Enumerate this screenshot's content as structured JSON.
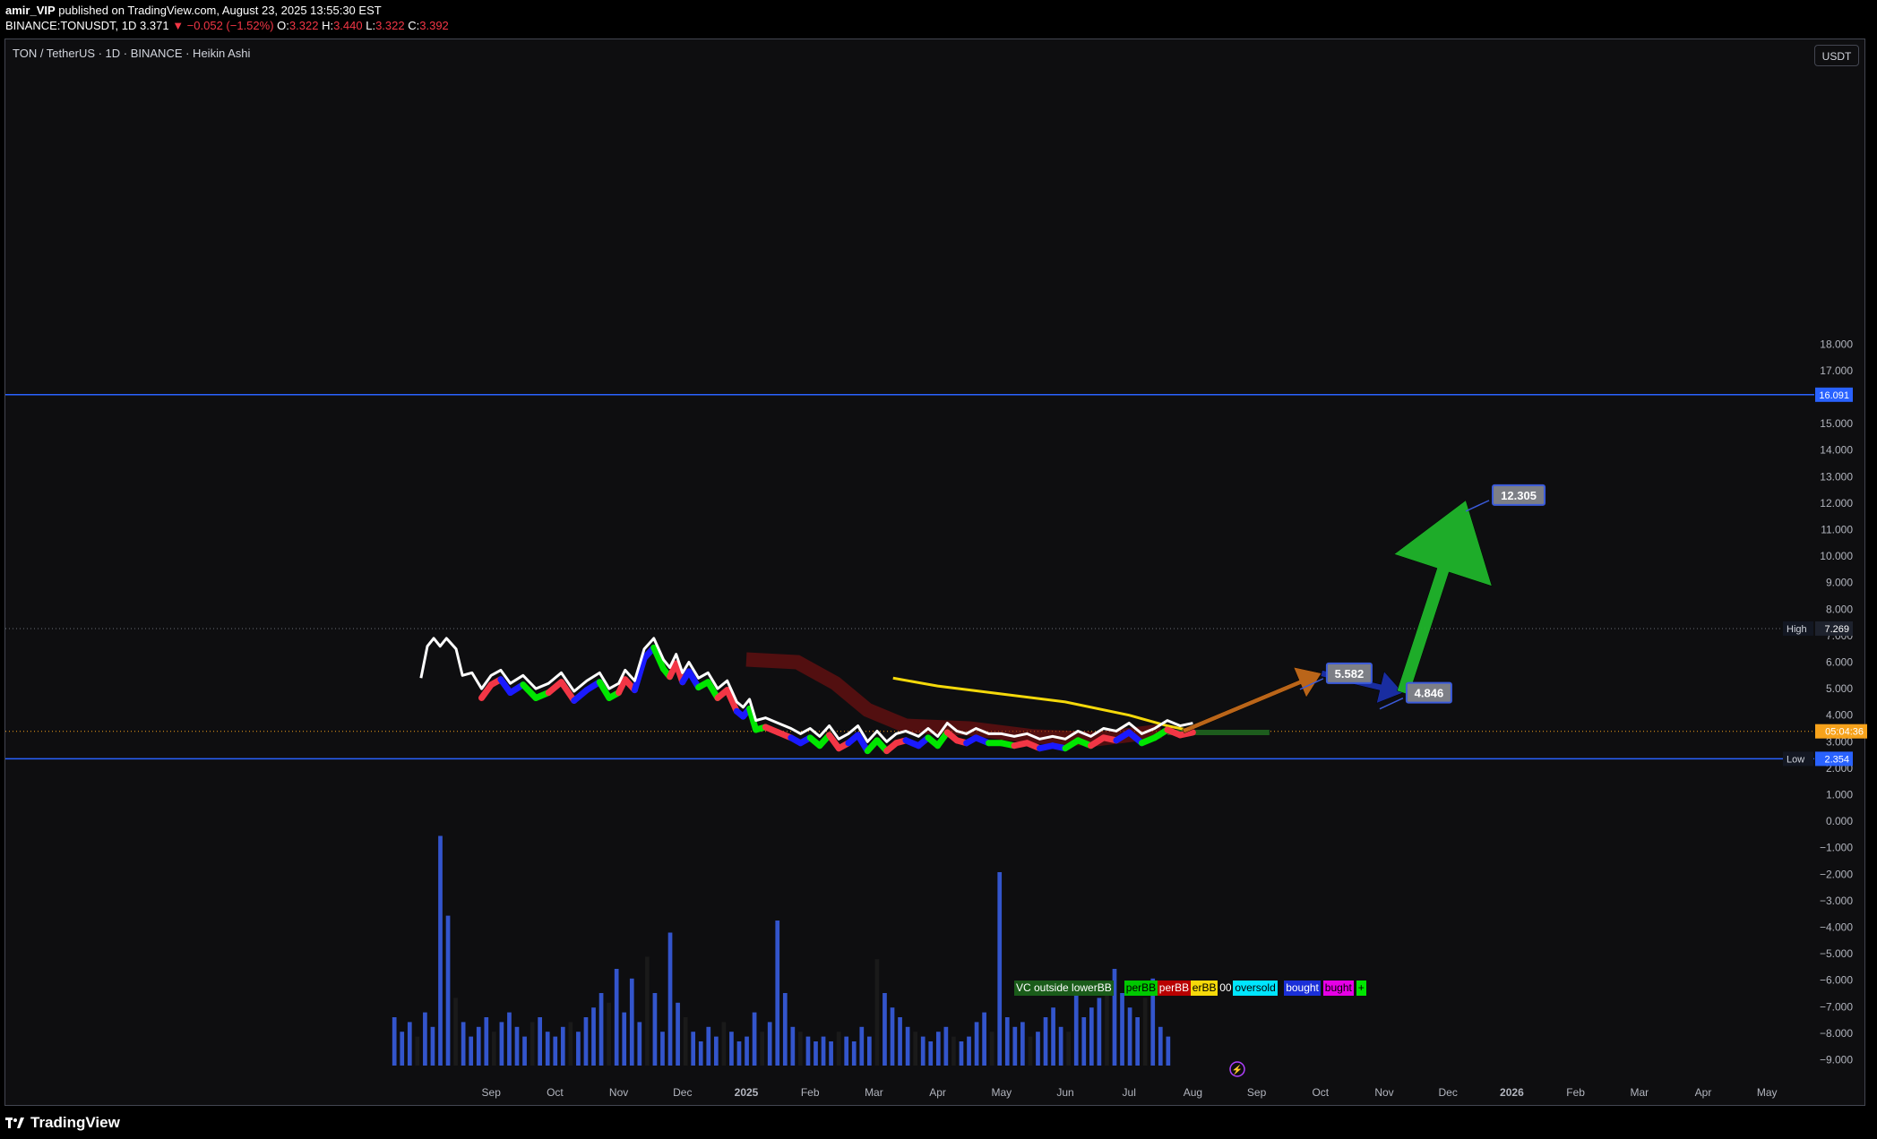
{
  "header": {
    "publisher": "amir_VIP",
    "published_text": "published on TradingView.com, August 23, 2025 13:55:30 EST",
    "symbol_full": "BINANCE:TONUSDT, 1D",
    "last": "3.371",
    "change": "▼ −0.052 (−1.52%)",
    "o_label": "O:",
    "o_value": "3.322",
    "h_label": "H:",
    "h_value": "3.440",
    "l_label": "L:",
    "l_value": "3.322",
    "c_label": "C:",
    "c_value": "3.392"
  },
  "chart_title": "TON / TetherUS · 1D · BINANCE · Heikin Ashi",
  "currency_button": "USDT",
  "footer": {
    "brand": "TradingView"
  },
  "colors": {
    "background": "#0e0e10",
    "blue_line": "#2962ff",
    "white_line": "#ffffff",
    "yellow_line": "#f5d90a",
    "bull": "#00e600",
    "bear": "#f23645",
    "volume": "#3355cc",
    "orange_arrow": "#c46a1a",
    "navy_arrow": "#1a2fa8",
    "green_arrow": "#1fb52b",
    "price_tag": "#f7a21b"
  },
  "chart_data": {
    "type": "line",
    "y_axis": {
      "min": -9.5,
      "max": 19,
      "ticks": [
        "18.000",
        "17.000",
        "16.000",
        "15.000",
        "14.000",
        "13.000",
        "12.000",
        "11.000",
        "10.000",
        "9.000",
        "8.000",
        "7.000",
        "6.000",
        "5.000",
        "4.000",
        "3.000",
        "2.000",
        "1.000",
        "0.000",
        "−1.000",
        "−2.000",
        "−3.000",
        "−4.000",
        "−5.000",
        "−6.000",
        "−7.000",
        "−8.000",
        "−9.000"
      ],
      "tick_values": [
        18,
        17,
        16,
        15,
        14,
        13,
        12,
        11,
        10,
        9,
        8,
        7,
        6,
        5,
        4,
        3,
        2,
        1,
        0,
        -1,
        -2,
        -3,
        -4,
        -5,
        -6,
        -7,
        -8,
        -9
      ]
    },
    "x_axis": {
      "labels": [
        "Sep",
        "Oct",
        "Nov",
        "Dec",
        "2025",
        "Feb",
        "Mar",
        "Apr",
        "May",
        "Jun",
        "Jul",
        "Aug",
        "Sep",
        "Oct",
        "Nov",
        "Dec",
        "2026",
        "Feb",
        "Mar",
        "Apr",
        "May"
      ],
      "label_months": [
        1,
        2,
        3,
        4,
        5,
        6,
        7,
        8,
        9,
        10,
        11,
        12,
        13,
        14,
        15,
        16,
        17,
        18,
        19,
        20,
        21
      ]
    },
    "horizontal_lines": [
      {
        "value": 16.091,
        "tag": "16.091",
        "style": "solid"
      },
      {
        "value": 7.269,
        "label": "High",
        "tag": "7.269",
        "style": "dotted"
      },
      {
        "value": 2.354,
        "label": "Low",
        "tag": "2.354",
        "style": "solid"
      }
    ],
    "current_price": {
      "value": 3.392,
      "countdown": "05:04:36"
    },
    "price_series": {
      "name": "",
      "points": [
        [
          -0.1,
          5.4
        ],
        [
          0,
          6.6
        ],
        [
          0.1,
          6.9
        ],
        [
          0.2,
          6.6
        ],
        [
          0.3,
          6.9
        ],
        [
          0.45,
          6.5
        ],
        [
          0.55,
          5.5
        ],
        [
          0.7,
          5.6
        ],
        [
          0.85,
          5.0
        ],
        [
          1.0,
          5.5
        ],
        [
          1.15,
          5.7
        ],
        [
          1.3,
          5.2
        ],
        [
          1.5,
          5.5
        ],
        [
          1.7,
          5.0
        ],
        [
          1.9,
          5.2
        ],
        [
          2.1,
          5.6
        ],
        [
          2.3,
          4.9
        ],
        [
          2.5,
          5.3
        ],
        [
          2.7,
          5.6
        ],
        [
          2.85,
          5.0
        ],
        [
          3.0,
          5.2
        ],
        [
          3.1,
          5.7
        ],
        [
          3.25,
          5.3
        ],
        [
          3.4,
          6.5
        ],
        [
          3.55,
          6.9
        ],
        [
          3.7,
          6.1
        ],
        [
          3.8,
          5.8
        ],
        [
          3.9,
          6.3
        ],
        [
          4.0,
          5.6
        ],
        [
          4.1,
          6.0
        ],
        [
          4.25,
          5.4
        ],
        [
          4.4,
          5.6
        ],
        [
          4.55,
          5.0
        ],
        [
          4.7,
          5.3
        ],
        [
          4.85,
          4.5
        ],
        [
          4.95,
          4.3
        ],
        [
          5.05,
          4.6
        ],
        [
          5.15,
          3.8
        ],
        [
          5.3,
          3.9
        ],
        [
          5.5,
          3.7
        ],
        [
          5.7,
          3.5
        ],
        [
          5.85,
          3.3
        ],
        [
          6.0,
          3.5
        ],
        [
          6.15,
          3.2
        ],
        [
          6.3,
          3.6
        ],
        [
          6.45,
          3.1
        ],
        [
          6.6,
          3.3
        ],
        [
          6.75,
          3.6
        ],
        [
          6.9,
          3.0
        ],
        [
          7.05,
          3.4
        ],
        [
          7.2,
          3.0
        ],
        [
          7.35,
          3.3
        ],
        [
          7.5,
          3.4
        ],
        [
          7.7,
          3.2
        ],
        [
          7.85,
          3.5
        ],
        [
          8.0,
          3.2
        ],
        [
          8.15,
          3.7
        ],
        [
          8.3,
          3.4
        ],
        [
          8.45,
          3.3
        ],
        [
          8.6,
          3.5
        ],
        [
          8.8,
          3.3
        ],
        [
          9.0,
          3.3
        ],
        [
          9.2,
          3.2
        ],
        [
          9.4,
          3.3
        ],
        [
          9.6,
          3.1
        ],
        [
          9.8,
          3.2
        ],
        [
          10.0,
          3.1
        ],
        [
          10.2,
          3.4
        ],
        [
          10.4,
          3.2
        ],
        [
          10.6,
          3.5
        ],
        [
          10.8,
          3.4
        ],
        [
          11.0,
          3.7
        ],
        [
          11.2,
          3.3
        ],
        [
          11.4,
          3.5
        ],
        [
          11.6,
          3.8
        ],
        [
          11.8,
          3.6
        ],
        [
          12.0,
          3.7
        ]
      ]
    },
    "moving_average": {
      "name": "",
      "points": [
        [
          7.3,
          5.4
        ],
        [
          8.0,
          5.1
        ],
        [
          9.0,
          4.8
        ],
        [
          10.0,
          4.5
        ],
        [
          11.0,
          4.0
        ],
        [
          11.6,
          3.6
        ],
        [
          12.0,
          3.4
        ]
      ]
    },
    "projection_targets": [
      {
        "month": 14.1,
        "value": 5.582,
        "tag": "5.582"
      },
      {
        "month": 15.35,
        "value": 4.846,
        "tag": "4.846"
      },
      {
        "month": 16.7,
        "value": 12.305,
        "tag": "12.305"
      }
    ],
    "volume_bars": {
      "max_heights_relative": true,
      "values": [
        0.2,
        0.14,
        0.18,
        0.12,
        0.22,
        0.16,
        0.95,
        0.62,
        0.28,
        0.18,
        0.12,
        0.16,
        0.2,
        0.14,
        0.18,
        0.22,
        0.16,
        0.12,
        0.18,
        0.2,
        0.14,
        0.12,
        0.16,
        0.18,
        0.14,
        0.2,
        0.24,
        0.3,
        0.26,
        0.4,
        0.22,
        0.36,
        0.18,
        0.45,
        0.3,
        0.14,
        0.55,
        0.26,
        0.2,
        0.14,
        0.1,
        0.16,
        0.12,
        0.18,
        0.14,
        0.1,
        0.12,
        0.22,
        0.14,
        0.18,
        0.6,
        0.3,
        0.16,
        0.14,
        0.12,
        0.1,
        0.12,
        0.1,
        0.14,
        0.12,
        0.1,
        0.16,
        0.12,
        0.44,
        0.3,
        0.24,
        0.2,
        0.16,
        0.14,
        0.12,
        0.1,
        0.14,
        0.16,
        0.12,
        0.1,
        0.12,
        0.18,
        0.22,
        0.14,
        0.8,
        0.2,
        0.16,
        0.18,
        0.12,
        0.14,
        0.2,
        0.24,
        0.16,
        0.14,
        0.3,
        0.2,
        0.24,
        0.28,
        0.34,
        0.4,
        0.3,
        0.24,
        0.2,
        0.28,
        0.36,
        0.16,
        0.12
      ]
    },
    "legend_tags": [
      {
        "text": "VC outside lowerBB",
        "bg": "#1a5c1a",
        "fg": "#ffffff"
      },
      {
        "text": "perBB",
        "bg": "#00c800",
        "fg": "#000000"
      },
      {
        "text": "perBB",
        "bg": "#b80000",
        "fg": "#ffffff"
      },
      {
        "text": "erBB",
        "bg": "#f5d90a",
        "fg": "#000000"
      },
      {
        "text": "00",
        "bg": "#0e0e10",
        "fg": "#ffffff"
      },
      {
        "text": "oversold",
        "bg": "#00e5ff",
        "fg": "#000000"
      },
      {
        "text": "bought",
        "bg": "#1a2fd8",
        "fg": "#ffffff"
      },
      {
        "text": "bught",
        "bg": "#e600e6",
        "fg": "#000000"
      },
      {
        "text": "+",
        "bg": "#00e600",
        "fg": "#000000"
      }
    ]
  }
}
